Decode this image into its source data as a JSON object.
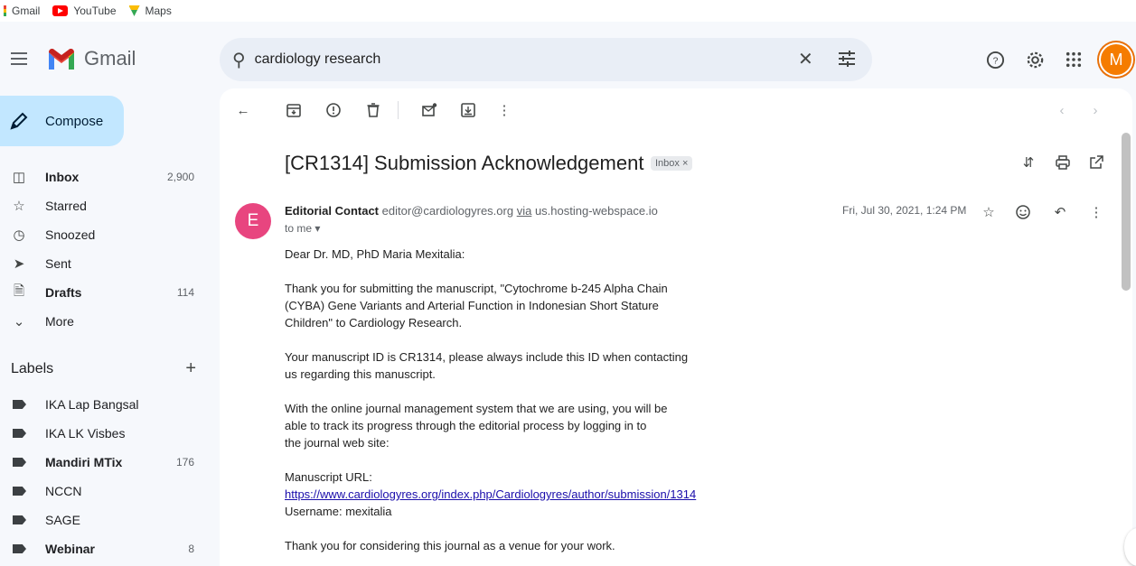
{
  "bookmarks": [
    {
      "label": "Gmail",
      "icon": "gmail-icon"
    },
    {
      "label": "YouTube",
      "icon": "youtube-icon"
    },
    {
      "label": "Maps",
      "icon": "maps-icon"
    }
  ],
  "app": {
    "name": "Gmail"
  },
  "search": {
    "value": "cardiology research"
  },
  "avatar_initial": "M",
  "compose": {
    "label": "Compose"
  },
  "nav": [
    {
      "label": "Inbox",
      "count": "2,900",
      "icon": "inbox-icon",
      "bold": true
    },
    {
      "label": "Starred",
      "count": "",
      "icon": "star-icon",
      "bold": false
    },
    {
      "label": "Snoozed",
      "count": "",
      "icon": "clock-icon",
      "bold": false
    },
    {
      "label": "Sent",
      "count": "",
      "icon": "send-icon",
      "bold": false
    },
    {
      "label": "Drafts",
      "count": "114",
      "icon": "draft-icon",
      "bold": true
    },
    {
      "label": "More",
      "count": "",
      "icon": "chevron-down-icon",
      "bold": false
    }
  ],
  "labels": {
    "title": "Labels",
    "items": [
      {
        "label": "IKA Lap Bangsal",
        "count": "",
        "bold": false
      },
      {
        "label": "IKA LK Visbes",
        "count": "",
        "bold": false
      },
      {
        "label": "Mandiri MTix",
        "count": "176",
        "bold": true
      },
      {
        "label": "NCCN",
        "count": "",
        "bold": false
      },
      {
        "label": "SAGE",
        "count": "",
        "bold": false
      },
      {
        "label": "Webinar",
        "count": "8",
        "bold": true
      }
    ]
  },
  "email": {
    "subject": "[CR1314] Submission Acknowledgement",
    "label_chip": "Inbox ×",
    "sender_initial": "E",
    "sender_name": "Editorial Contact",
    "sender_email": "editor@cardiologyres.org",
    "via_word": "via",
    "via_domain": "us.hosting-webspace.io",
    "to": "to me ▾",
    "date": "Fri, Jul 30, 2021, 1:24 PM",
    "greeting": "Dear Dr. MD, PhD Maria Mexitalia:",
    "p1_l1": "Thank you for submitting the manuscript, \"Cytochrome b-245 Alpha Chain",
    "p1_l2": "(CYBA) Gene Variants and Arterial Function in Indonesian Short Stature",
    "p1_l3": "Children\" to Cardiology Research.",
    "p2_l1": "Your manuscript ID is CR1314, please always include this ID when contacting",
    "p2_l2": "us regarding this manuscript.",
    "p3_l1": "With the online journal management system that we are using, you will be",
    "p3_l2": "able to track its progress through the editorial process by logging in to",
    "p3_l3": "the journal web site:",
    "url_label": "Manuscript URL:",
    "url": "https://www.cardiologyres.org/index.php/Cardiologyres/author/submission/1314",
    "username": "Username: mexitalia",
    "closing": "Thank you for considering this journal as a venue for your work."
  },
  "colors": {
    "accent": "#c2e7ff",
    "avatar_e": "#e8457f",
    "avatar_m": "#f57c00",
    "link": "#1a0dab"
  }
}
